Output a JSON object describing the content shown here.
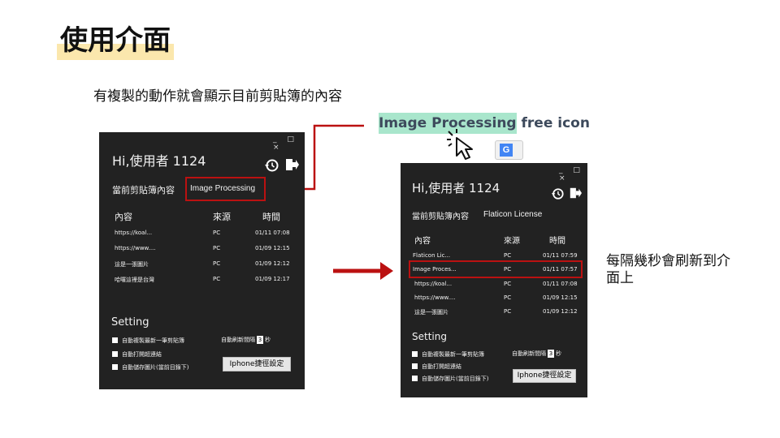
{
  "slide": {
    "title": "使用介面",
    "subtitle": "有複製的動作就會顯示目前剪貼簿的內容",
    "note": "每隔幾秒會刷新到介面上",
    "web_title_highlight": "Image Processing",
    "web_title_rest": " free icon"
  },
  "colors": {
    "accent_red": "#b11",
    "window_bg": "#222222",
    "highlight_green": "#a9e6cc",
    "title_highlight": "#fbe7ad"
  },
  "window_controls": "_ □ ×",
  "left_window": {
    "greeting": "Hi,使用者 1124",
    "clipboard_label": "當前剪貼簿內容",
    "clipboard_value": "Image Processing",
    "columns": [
      "內容",
      "來源",
      "時間"
    ],
    "rows": [
      {
        "content": "https://koal...",
        "source": "PC",
        "time": "01/11 07:08"
      },
      {
        "content": "https://www....",
        "source": "PC",
        "time": "01/09 12:15"
      },
      {
        "content": "這是一張圖片",
        "source": "PC",
        "time": "01/09 12:12"
      },
      {
        "content": "哈囉這裡是台灣",
        "source": "PC",
        "time": "01/09 12:17"
      }
    ],
    "setting_title": "Setting",
    "opt_auto_copy": "自動複製最新一筆剪貼簿",
    "opt_auto_link": "自動打開超連結",
    "opt_auto_save": "自動儲存圖片(當前目錄下)",
    "refresh_label": "自動刷新間隔",
    "refresh_value": "3",
    "refresh_unit": "秒",
    "iphone_button": "Iphone捷徑設定"
  },
  "right_window": {
    "greeting": "Hi,使用者 1124",
    "clipboard_label": "當前剪貼簿內容",
    "clipboard_value": "Flaticon License",
    "columns": [
      "內容",
      "來源",
      "時間"
    ],
    "rows": [
      {
        "content": "Flaticon Lic...",
        "source": "PC",
        "time": "01/11 07:59"
      },
      {
        "content": "Image Proces...",
        "source": "PC",
        "time": "01/11 07:57"
      },
      {
        "content": "https://koal...",
        "source": "PC",
        "time": "01/11 07:08"
      },
      {
        "content": "https://www....",
        "source": "PC",
        "time": "01/09 12:15"
      },
      {
        "content": "這是一張圖片",
        "source": "PC",
        "time": "01/09 12:12"
      }
    ],
    "setting_title": "Setting",
    "opt_auto_copy": "自動複製最新一筆剪貼簿",
    "opt_auto_link": "自動打開超連結",
    "opt_auto_save": "自動儲存圖片(當前目錄下)",
    "refresh_label": "自動刷新間隔",
    "refresh_value": "3",
    "refresh_unit": "秒",
    "iphone_button": "Iphone捷徑設定"
  }
}
